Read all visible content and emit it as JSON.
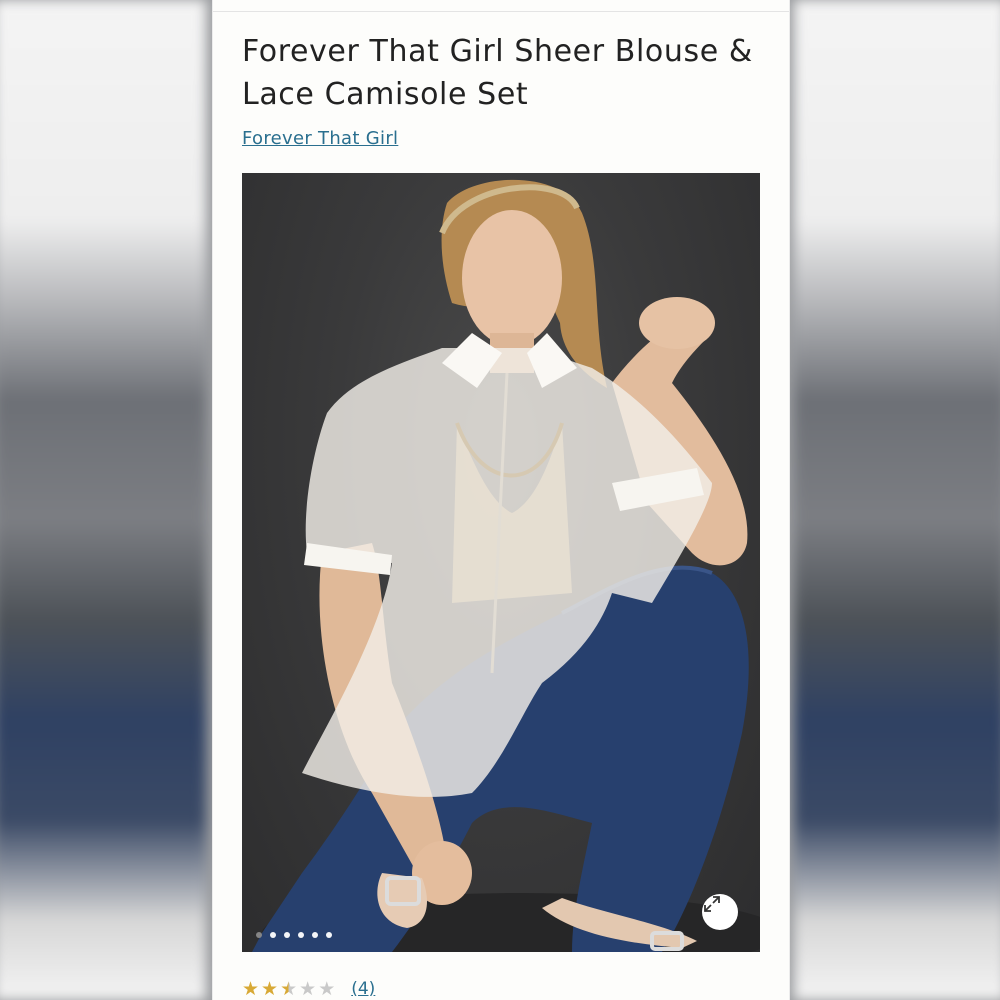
{
  "product": {
    "title": "Forever That Girl Sheer Blouse & Lace Camisole Set",
    "brand": "Forever That Girl"
  },
  "gallery": {
    "image_alt": "Model wearing a sheer white short-sleeve blouse over a lace camisole with dark blue jeans, crouching against a dark grey backdrop",
    "current_slide": 1,
    "total_slides": 6,
    "expand_icon": "expand-arrows-icon"
  },
  "reviews": {
    "rating": 2.5,
    "max_rating": 5,
    "count_label": "(4)"
  },
  "colors": {
    "link": "#2a6f8f",
    "star": "#d8a935",
    "star_empty": "#c9c9c9",
    "backdrop": "#3a3a3b"
  }
}
